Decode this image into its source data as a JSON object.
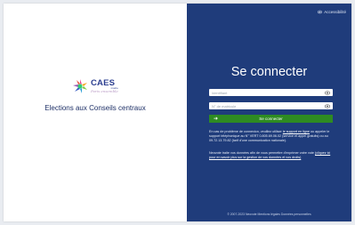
{
  "brand": {
    "name": "CAES",
    "subtitle": "mairie",
    "tagline": "Paris ensemble"
  },
  "left": {
    "title": "Elections aux Conseils centraux"
  },
  "header": {
    "accessibility_label": "Accessibilité"
  },
  "login": {
    "title": "Se connecter",
    "identifier_placeholder": "Identifiant",
    "matricule_placeholder": "N° de matricule",
    "submit_label": "Se connecter"
  },
  "help": {
    "p1_before": "En cas de problème de connexion, veuillez utiliser ",
    "p1_link": "le support en ligne",
    "p1_after": " ou appeler le support téléphonique au N° VERT 0.805.69.06.02 (service et appel gratuits) ou au 09.72.13.79.82 (tarif d'une communication nationale).",
    "p2_before": "Neovote traite vos données afin de vous permettre d'exprimer votre vote ",
    "p2_link": "(cliquez ici pour en savoir plus sur la gestion de vos données et vos droits)"
  },
  "footer": {
    "text": "© 2007-2023 Neovote   Mentions légales   Données personnelles"
  },
  "colors": {
    "panel": "#1f3c7b",
    "button": "#2e8b22",
    "title_text": "#1d2f66"
  }
}
